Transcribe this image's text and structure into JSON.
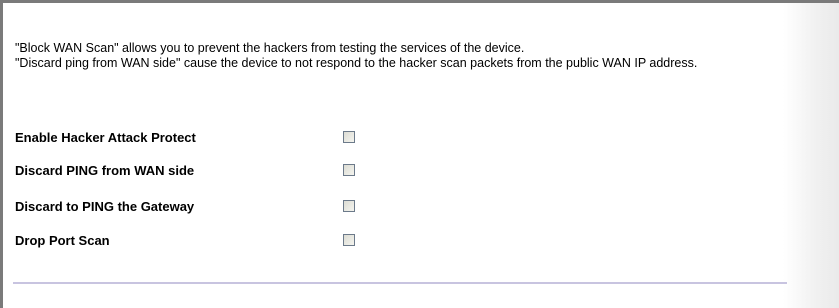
{
  "description": {
    "line1": "\"Block WAN Scan\" allows you to prevent the hackers from testing the services of the device.",
    "line2": "\"Discard ping from WAN side\" cause the device to not respond to the hacker scan packets from the public WAN IP address."
  },
  "options": [
    {
      "label": "Enable Hacker Attack Protect",
      "checked": false
    },
    {
      "label": "Discard PING from WAN side",
      "checked": false
    },
    {
      "label": "Discard to PING the Gateway",
      "checked": false
    },
    {
      "label": "Drop Port Scan",
      "checked": false
    }
  ],
  "colors": {
    "frame_border": "#7a7a7a",
    "divider": "#c8c4e0",
    "checkbox_border": "#6c7a8a"
  }
}
